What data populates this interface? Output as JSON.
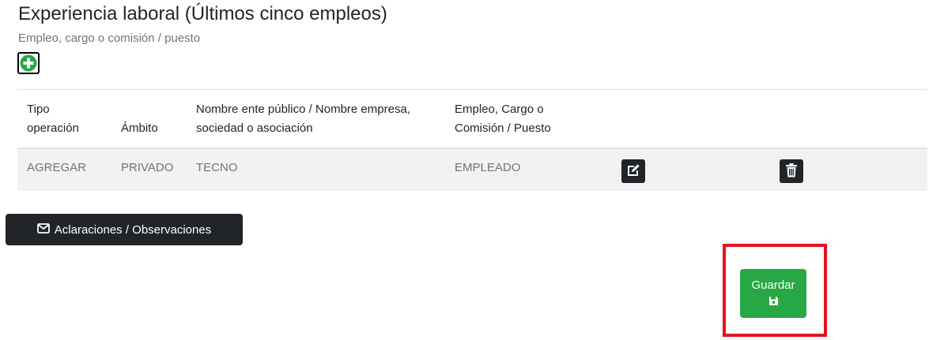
{
  "section": {
    "title": "Experiencia laboral (Últimos cinco empleos)",
    "subtitle": "Empleo, cargo o comisión / puesto"
  },
  "add_button": {
    "icon": "plus-circle-icon",
    "color": "#28a745"
  },
  "table": {
    "headers": [
      {
        "line1": "Tipo",
        "line2": "operación"
      },
      {
        "line1": "",
        "line2": "Ámbito"
      },
      {
        "line1": "Nombre ente público / Nombre empresa,",
        "line2": "sociedad o asociación"
      },
      {
        "line1": "Empleo, Cargo o",
        "line2": "Comisión / Puesto"
      }
    ],
    "rows": [
      {
        "tipo_operacion": "AGREGAR",
        "ambito": "PRIVADO",
        "nombre_ente": "TECNO",
        "empleo": "EMPLEADO",
        "edit_icon": "edit-icon",
        "delete_icon": "trash-icon"
      }
    ]
  },
  "notes_button": {
    "icon": "envelope-icon",
    "label": "Aclaraciones / Observaciones"
  },
  "save_button": {
    "label": "Guardar",
    "icon": "floppy-disk-icon",
    "color": "#28a745"
  },
  "highlight_color": "#e0141e"
}
